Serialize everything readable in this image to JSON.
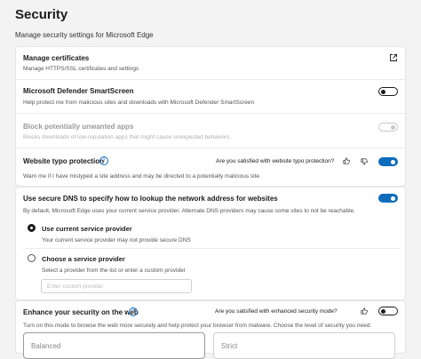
{
  "page": {
    "title": "Security",
    "subtitle": "Manage security settings for Microsoft Edge"
  },
  "certificates": {
    "title": "Manage certificates",
    "desc": "Manage HTTPS/SSL certificates and settings"
  },
  "smartscreen": {
    "title": "Microsoft Defender SmartScreen",
    "desc": "Help protect me from malicious sites and downloads with Microsoft Defender SmartScreen",
    "enabled": false
  },
  "pua": {
    "title": "Block potentially unwanted apps",
    "desc": "Blocks downloads of low-reputation apps that might cause unexpected behaviors",
    "enabled": false,
    "disabled": true
  },
  "typo": {
    "title": "Website typo protection",
    "desc": "Warn me if I have mistyped a site address and may be directed to a potentially malicious site.",
    "feedback": "Are you satisfied with website typo protection?",
    "enabled": true
  },
  "dns": {
    "title": "Use secure DNS to specify how to lookup the network address for websites",
    "desc": "By default, Microsoft Edge uses your current service provider. Alternate DNS providers may cause some sites to not be reachable.",
    "enabled": true,
    "option_current_title": "Use current service provider",
    "option_current_desc": "Your current service provider may not provide secure DNS",
    "option_choose_title": "Choose a service provider",
    "option_choose_desc": "Select a provider from the list or enter a custom provider",
    "custom_placeholder": "Enter custom provider"
  },
  "enhanced": {
    "title": "Enhance your security on the web",
    "feedback": "Are you satisfied with enhanced security mode?",
    "desc": "Turn on this mode to browse the web more securely and help protect your browser from malware. Choose the level of security you need:",
    "enabled": false,
    "levels": [
      "Balanced",
      "Strict"
    ]
  },
  "colors": {
    "accent": "#0f6cbd",
    "background": "#f3f3f3"
  }
}
